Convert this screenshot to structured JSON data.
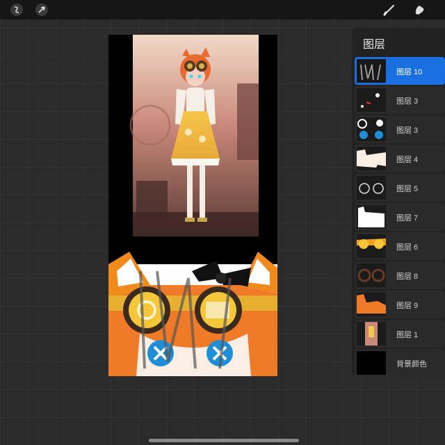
{
  "toolbar": {
    "left_tools": [
      "adjustments-icon",
      "selection-arrow-icon"
    ],
    "right_tools": [
      "brush-icon",
      "smudge-icon"
    ]
  },
  "layers_panel": {
    "title": "图层",
    "layers": [
      {
        "label": "图层 10",
        "active": true
      },
      {
        "label": "图层 3",
        "active": false
      },
      {
        "label": "图层 3",
        "active": false
      },
      {
        "label": "图层 4",
        "active": false
      },
      {
        "label": "图层 5",
        "active": false
      },
      {
        "label": "图层 7",
        "active": false
      },
      {
        "label": "图层 6",
        "active": false
      },
      {
        "label": "图层 8",
        "active": false
      },
      {
        "label": "图层 9",
        "active": false
      },
      {
        "label": "图层 1",
        "active": false
      },
      {
        "label": "背景颜色",
        "active": false
      }
    ]
  },
  "colors": {
    "accent": "#1a6fe0",
    "canvas_bg": "#000000",
    "panel_bg": "#222222"
  }
}
